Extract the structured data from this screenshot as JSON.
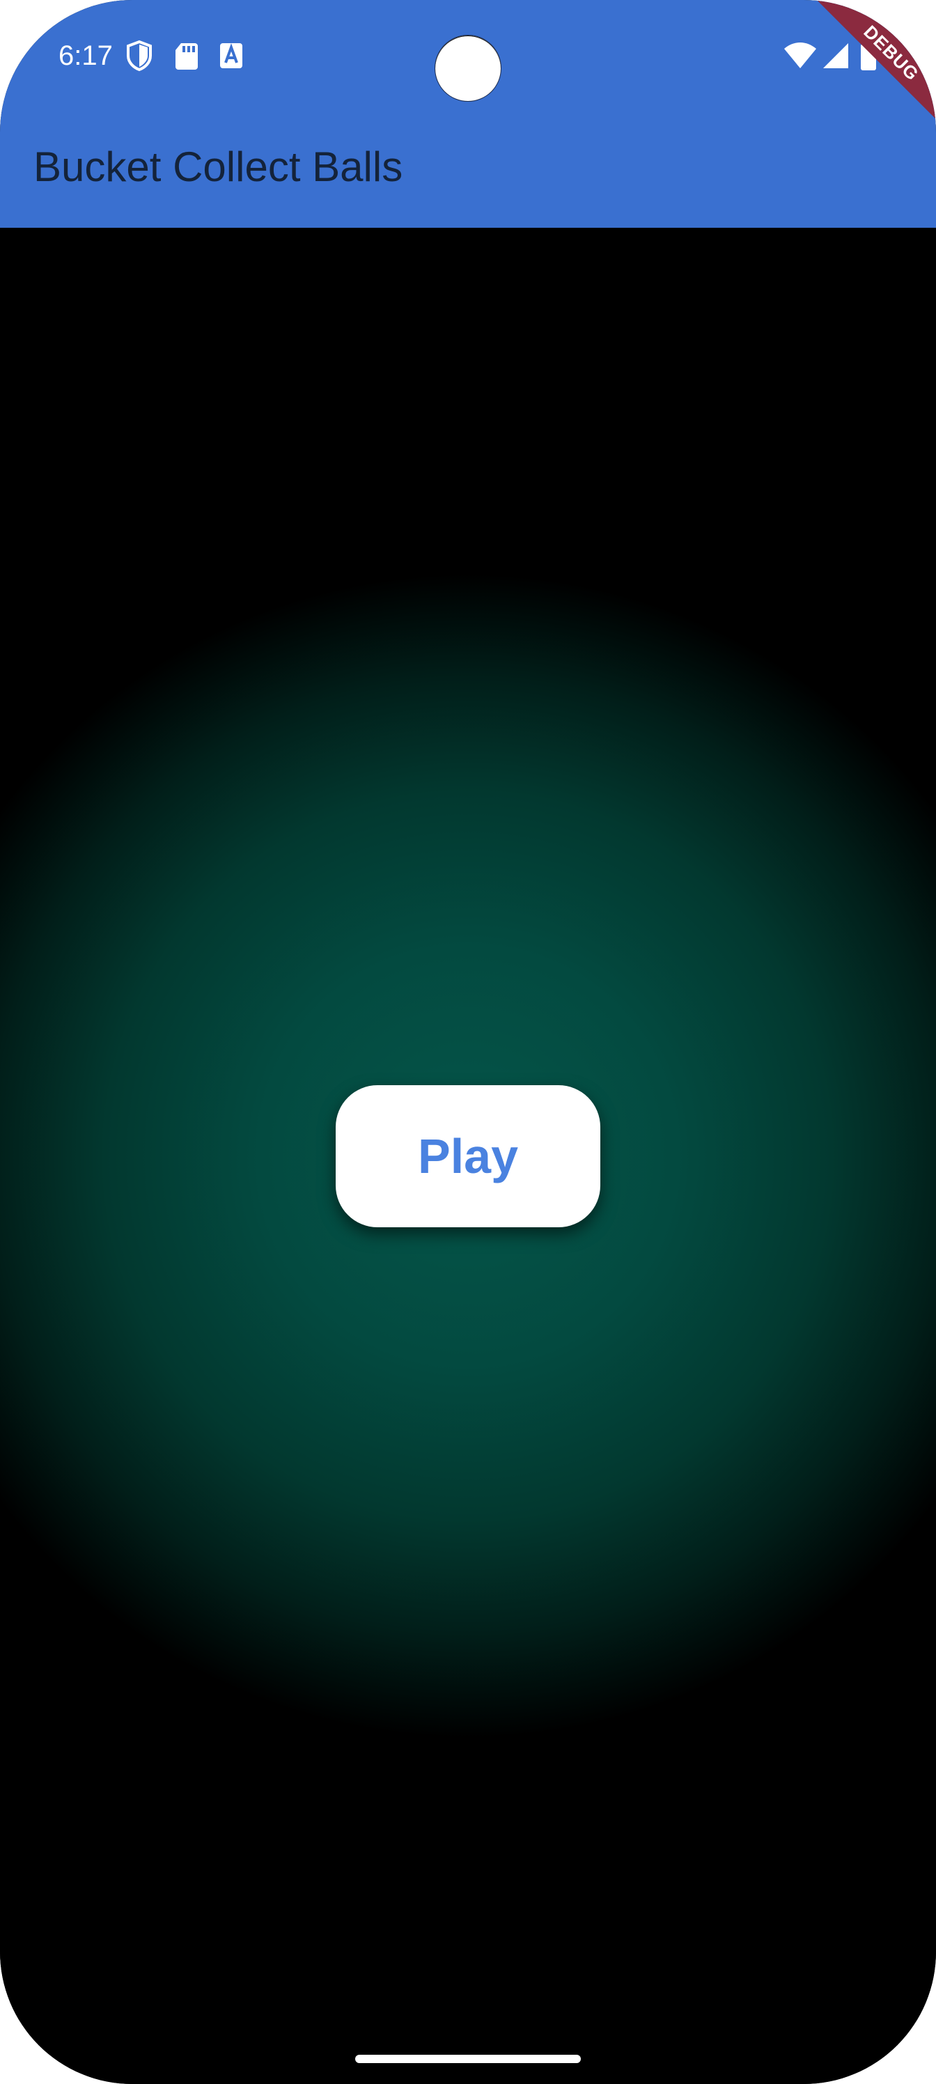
{
  "status_bar": {
    "time": "6:17",
    "icons": [
      "shield-icon",
      "sd-card-icon",
      "font-icon",
      "wifi-icon",
      "signal-icon",
      "battery-icon"
    ]
  },
  "debug_banner": {
    "label": "DEBUG",
    "color": "#8B2A3F"
  },
  "appbar": {
    "title": "Bucket Collect Balls",
    "color": "#3A70D0"
  },
  "main": {
    "play_label": "Play",
    "gradient_center_color": "#05564A",
    "background_color": "#000000",
    "button_text_color": "#4A82E0"
  }
}
